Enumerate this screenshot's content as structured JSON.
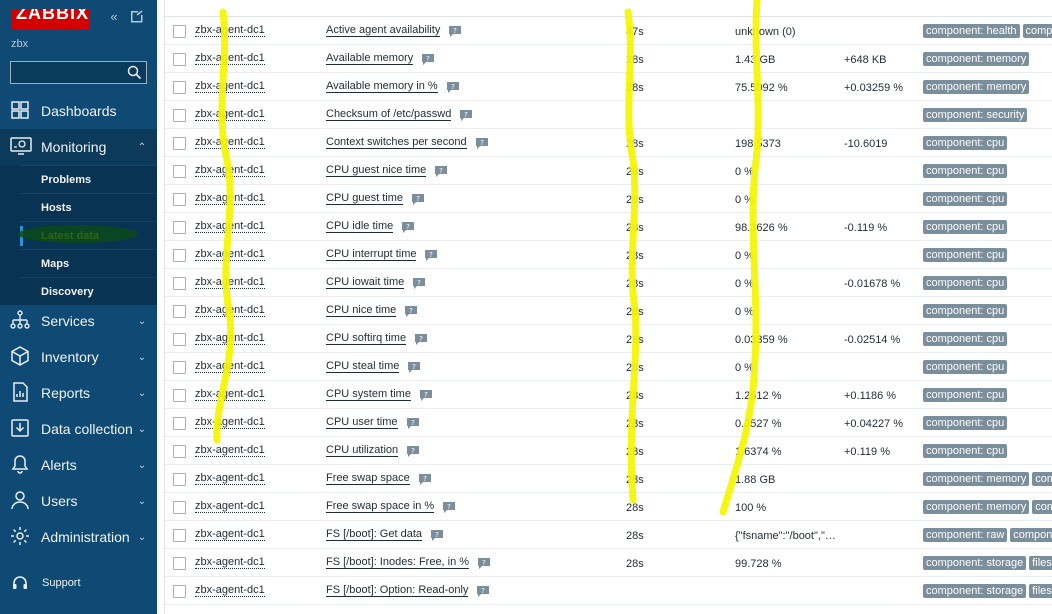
{
  "sidebar": {
    "logo": "ZABBIX",
    "server": "zbx",
    "search_placeholder": "",
    "nav": [
      {
        "label": "Dashboards",
        "icon": "dashboards-icon",
        "chevron": ""
      },
      {
        "label": "Monitoring",
        "icon": "monitoring-icon",
        "chevron": "⌃"
      },
      {
        "label": "Services",
        "icon": "services-icon",
        "chevron": "⌄"
      },
      {
        "label": "Inventory",
        "icon": "inventory-icon",
        "chevron": "⌄"
      },
      {
        "label": "Reports",
        "icon": "reports-icon",
        "chevron": "⌄"
      },
      {
        "label": "Data collection",
        "icon": "data-collection-icon",
        "chevron": "⌄"
      },
      {
        "label": "Alerts",
        "icon": "alerts-icon",
        "chevron": "⌄"
      },
      {
        "label": "Users",
        "icon": "users-icon",
        "chevron": "⌄"
      },
      {
        "label": "Administration",
        "icon": "administration-icon",
        "chevron": "⌄"
      }
    ],
    "monitoring_submenu": [
      "Problems",
      "Hosts",
      "Latest data",
      "Maps",
      "Discovery"
    ],
    "support": "Support"
  },
  "items": [
    {
      "host": "zbx-agent-dc1",
      "name": "Active agent availability",
      "interval": "47s",
      "last": "unknown (0)",
      "change": "",
      "tags": [
        "component: health",
        "comp"
      ]
    },
    {
      "host": "zbx-agent-dc1",
      "name": "Available memory",
      "interval": "28s",
      "last": "1.43 GB",
      "change": "+648 KB",
      "tags": [
        "component: memory"
      ]
    },
    {
      "host": "zbx-agent-dc1",
      "name": "Available memory in %",
      "interval": "28s",
      "last": "75.5092 %",
      "change": "+0.03259 %",
      "tags": [
        "component: memory"
      ]
    },
    {
      "host": "zbx-agent-dc1",
      "name": "Checksum of /etc/passwd",
      "interval": "",
      "last": "",
      "change": "",
      "tags": [
        "component: security"
      ]
    },
    {
      "host": "zbx-agent-dc1",
      "name": "Context switches per second",
      "interval": "28s",
      "last": "198.5373",
      "change": "-10.6019",
      "tags": [
        "component: cpu"
      ]
    },
    {
      "host": "zbx-agent-dc1",
      "name": "CPU guest nice time",
      "interval": "28s",
      "last": "0 %",
      "change": "",
      "tags": [
        "component: cpu"
      ]
    },
    {
      "host": "zbx-agent-dc1",
      "name": "CPU guest time",
      "interval": "28s",
      "last": "0 %",
      "change": "",
      "tags": [
        "component: cpu"
      ]
    },
    {
      "host": "zbx-agent-dc1",
      "name": "CPU idle time",
      "interval": "28s",
      "last": "98.3626 %",
      "change": "-0.119 %",
      "tags": [
        "component: cpu"
      ]
    },
    {
      "host": "zbx-agent-dc1",
      "name": "CPU interrupt time",
      "interval": "28s",
      "last": "0 %",
      "change": "",
      "tags": [
        "component: cpu"
      ]
    },
    {
      "host": "zbx-agent-dc1",
      "name": "CPU iowait time",
      "interval": "28s",
      "last": "0 %",
      "change": "-0.01678 %",
      "tags": [
        "component: cpu"
      ]
    },
    {
      "host": "zbx-agent-dc1",
      "name": "CPU nice time",
      "interval": "28s",
      "last": "0 %",
      "change": "",
      "tags": [
        "component: cpu"
      ]
    },
    {
      "host": "zbx-agent-dc1",
      "name": "CPU softirq time",
      "interval": "28s",
      "last": "0.03359 %",
      "change": "-0.02514 %",
      "tags": [
        "component: cpu"
      ]
    },
    {
      "host": "zbx-agent-dc1",
      "name": "CPU steal time",
      "interval": "28s",
      "last": "0 %",
      "change": "",
      "tags": [
        "component: cpu"
      ]
    },
    {
      "host": "zbx-agent-dc1",
      "name": "CPU system time",
      "interval": "28s",
      "last": "1.2512 %",
      "change": "+0.1186 %",
      "tags": [
        "component: cpu"
      ]
    },
    {
      "host": "zbx-agent-dc1",
      "name": "CPU user time",
      "interval": "28s",
      "last": "0.3527 %",
      "change": "+0.04227 %",
      "tags": [
        "component: cpu"
      ]
    },
    {
      "host": "zbx-agent-dc1",
      "name": "CPU utilization",
      "interval": "28s",
      "last": "1.6374 %",
      "change": "+0.119 %",
      "tags": [
        "component: cpu"
      ]
    },
    {
      "host": "zbx-agent-dc1",
      "name": "Free swap space",
      "interval": "28s",
      "last": "1.88 GB",
      "change": "",
      "tags": [
        "component: memory",
        "comp"
      ]
    },
    {
      "host": "zbx-agent-dc1",
      "name": "Free swap space in %",
      "interval": "28s",
      "last": "100 %",
      "change": "",
      "tags": [
        "component: memory",
        "comp"
      ]
    },
    {
      "host": "zbx-agent-dc1",
      "name": "FS [/boot]: Get data",
      "interval": "28s",
      "last": "{\"fsname\":\"/boot\",\"…",
      "change": "",
      "tags": [
        "component: raw",
        "compone"
      ]
    },
    {
      "host": "zbx-agent-dc1",
      "name": "FS [/boot]: Inodes: Free, in %",
      "interval": "28s",
      "last": "99.728 %",
      "change": "",
      "tags": [
        "component: storage",
        "filesy"
      ]
    },
    {
      "host": "zbx-agent-dc1",
      "name": "FS [/boot]: Option: Read-only",
      "interval": "",
      "last": "",
      "change": "",
      "tags": [
        "component: storage",
        "filesy"
      ]
    }
  ],
  "colors": {
    "sidebar_bg": "#0e4a74",
    "tag_bg": "#7b8e9c",
    "selected_text": "#f7f700",
    "annotation": "#f5f500"
  }
}
